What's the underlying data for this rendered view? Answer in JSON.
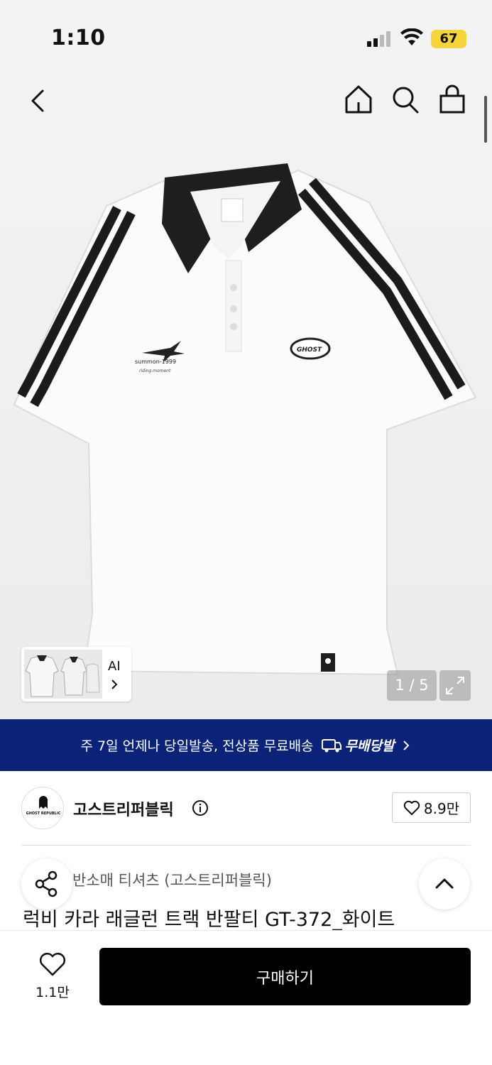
{
  "status_bar": {
    "time": "1:10",
    "battery": "67"
  },
  "top_nav": {
    "back_icon": "chevron-left-icon",
    "home_icon": "home-icon",
    "search_icon": "search-icon",
    "bag_icon": "shopping-bag-icon"
  },
  "gallery": {
    "ai_label": "AI",
    "counter": "1 / 5",
    "expand_icon": "expand-icon"
  },
  "shirt_print": {
    "left_chest": "summon-1999",
    "left_chest_sub": "riding moment",
    "right_badge": "GHOST"
  },
  "banner": {
    "text": "주 7일 언제나 당일발송, 전상품 무료배송",
    "brand": "무배당발"
  },
  "seller": {
    "name": "고스트리퍼블릭",
    "logo_text": "GHOST REPUBLIC",
    "likes": "8.9만"
  },
  "product": {
    "category": "반소매 티셔츠 (고스트리퍼블릭)",
    "title": "럭비 카라 래글런 트랙 반팔티 GT-372_화이트"
  },
  "bottom_bar": {
    "wish_count": "1.1만",
    "buy_label": "구매하기"
  },
  "colors": {
    "banner_bg": "#0a2278",
    "buy_bg": "#000000",
    "battery": "#f5d53b"
  }
}
